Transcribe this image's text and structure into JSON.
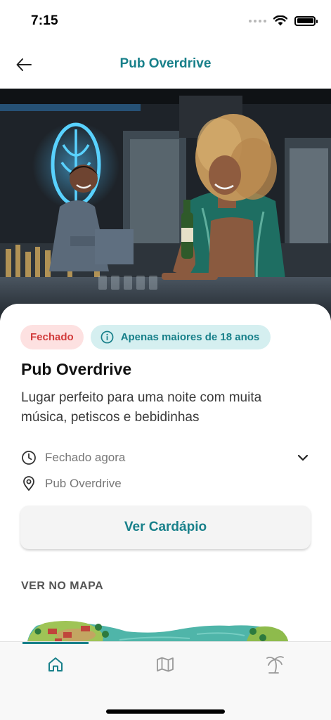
{
  "status_bar": {
    "time": "7:15"
  },
  "nav": {
    "title": "Pub Overdrive",
    "back_icon": "arrow-left-icon"
  },
  "hero": {
    "pager_pages": 1,
    "pager_active": 0
  },
  "chips": {
    "closed": "Fechado",
    "age": "Apenas maiores de 18 anos"
  },
  "place": {
    "title": "Pub Overdrive",
    "description": "Lugar perfeito para uma noite com muita música, petiscos e bebidinhas",
    "hours": "Fechado agora",
    "location": "Pub Overdrive"
  },
  "menu_button": "Ver Cardápio",
  "map_section": {
    "label": "VER NO MAPA"
  },
  "tabs": [
    {
      "name": "home",
      "icon": "home-icon",
      "active": true
    },
    {
      "name": "map",
      "icon": "map-icon",
      "active": false
    },
    {
      "name": "activities",
      "icon": "palm-tree-icon",
      "active": false
    }
  ],
  "colors": {
    "accent": "#18808a",
    "closed_bg": "#fde1e1",
    "closed_text": "#d23c3c",
    "age_bg": "#d5eff0",
    "sheet_bg": "#ffffff",
    "tab_bar_bg": "#f8f8f8"
  }
}
